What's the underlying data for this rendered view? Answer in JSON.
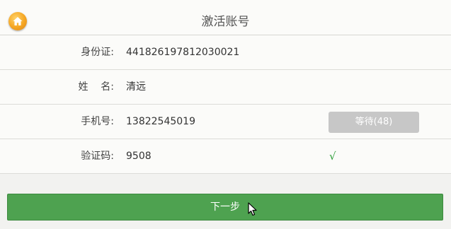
{
  "header": {
    "title": "激活账号",
    "home_icon": "home-icon"
  },
  "form": {
    "id_card": {
      "label": "身份证:",
      "value": "441826197812030021"
    },
    "name": {
      "label": "姓    名:",
      "value": "清远"
    },
    "phone": {
      "label": "手机号:",
      "value": "13822545019",
      "wait_button": "等待(48)"
    },
    "code": {
      "label": "验证码:",
      "value": "9508",
      "check_mark": "√"
    }
  },
  "actions": {
    "next_label": "下一步"
  },
  "colors": {
    "accent_green": "#4ea250",
    "disabled_gray": "#c7c7c7",
    "home_orange": "#f5a623",
    "check_green": "#2e9e3a"
  }
}
